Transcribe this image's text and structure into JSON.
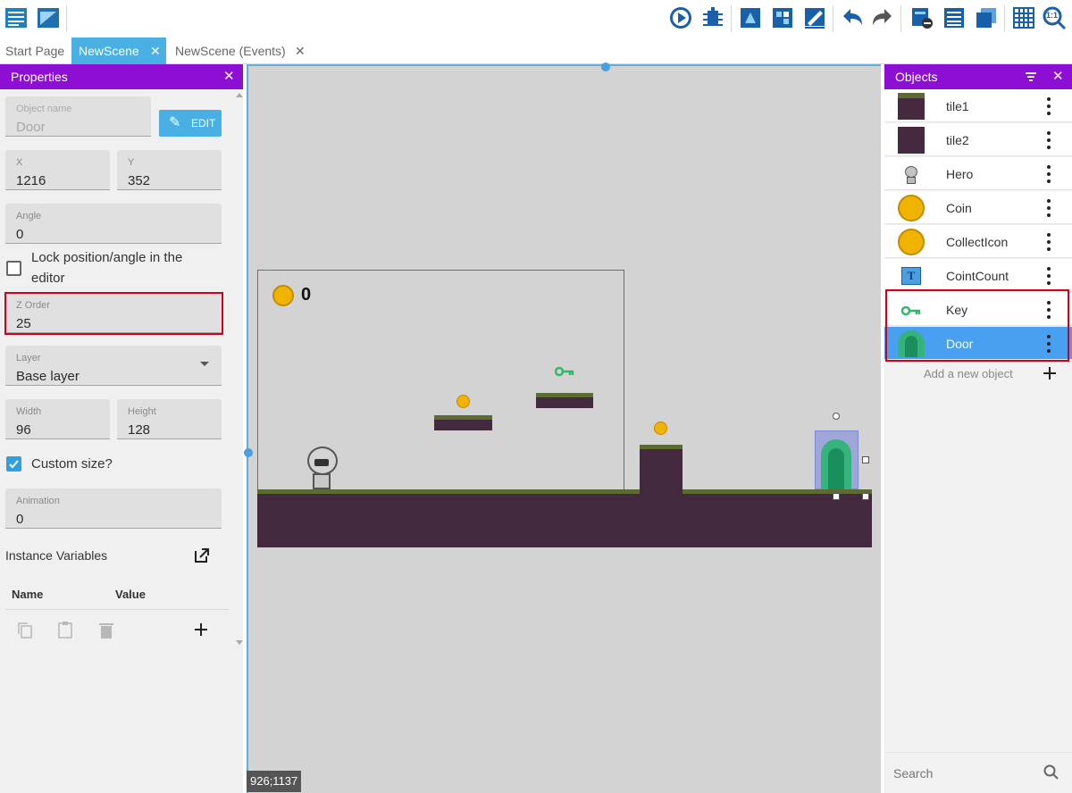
{
  "toolbar": {
    "icons": [
      "project-manager-icon",
      "scene-window-icon",
      "preview-play-icon",
      "debugger-icon",
      "export-icon",
      "share-icon",
      "edit-scene-icon",
      "undo-icon",
      "redo-icon",
      "layers-icon",
      "instances-list-icon",
      "objects-groups-icon",
      "grid-icon",
      "zoom-reset-icon"
    ],
    "zoom_label": "1:1"
  },
  "tabs": [
    {
      "label": "Start Page",
      "active": false
    },
    {
      "label": "NewScene",
      "active": true
    },
    {
      "label": "NewScene (Events)",
      "active": false
    }
  ],
  "properties": {
    "title": "Properties",
    "close": "✕",
    "object_name_label": "Object name",
    "object_name_value": "Door",
    "edit_label": "EDIT",
    "x_label": "X",
    "x_value": "1216",
    "y_label": "Y",
    "y_value": "352",
    "angle_label": "Angle",
    "angle_value": "0",
    "lock_label_1": "Lock position/angle in the",
    "lock_label_2": "editor",
    "lock_checked": false,
    "zorder_label": "Z Order",
    "zorder_value": "25",
    "layer_label": "Layer",
    "layer_value": "Base layer",
    "width_label": "Width",
    "width_value": "96",
    "height_label": "Height",
    "height_value": "128",
    "custom_size_label": "Custom size?",
    "custom_size_checked": true,
    "animation_label": "Animation",
    "animation_value": "0",
    "instance_vars_label": "Instance Variables",
    "col_name": "Name",
    "col_value": "Value"
  },
  "scene": {
    "coin_counter": "0",
    "coordinates": "926;1137"
  },
  "objects": {
    "title": "Objects",
    "items": [
      {
        "name": "tile1",
        "icon": "tile1-icon"
      },
      {
        "name": "tile2",
        "icon": "tile2-icon"
      },
      {
        "name": "Hero",
        "icon": "hero-icon"
      },
      {
        "name": "Coin",
        "icon": "coin-icon"
      },
      {
        "name": "CollectIcon",
        "icon": "coin-icon"
      },
      {
        "name": "CointCount",
        "icon": "text-object-icon"
      },
      {
        "name": "Key",
        "icon": "key-icon"
      },
      {
        "name": "Door",
        "icon": "door-icon",
        "selected": true
      }
    ],
    "add_label": "Add a new object",
    "search_placeholder": "Search"
  },
  "colors": {
    "panel_header": "#8e0fd4",
    "accent": "#4ab0e4",
    "selected_row": "#4aa0f0",
    "highlight": "#d0021b"
  }
}
